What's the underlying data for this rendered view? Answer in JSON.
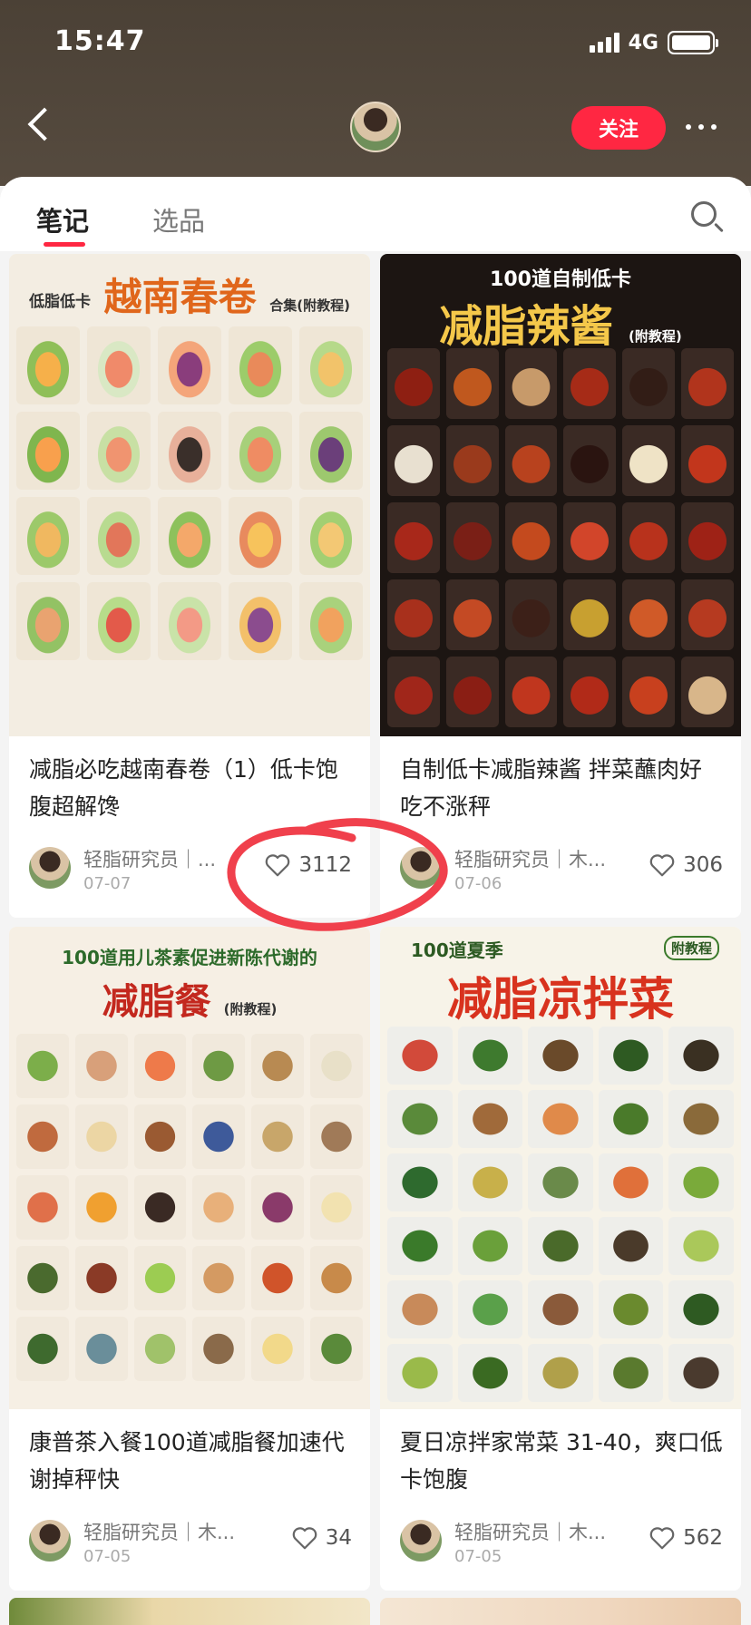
{
  "status_bar": {
    "time": "15:47",
    "network": "4G"
  },
  "header": {
    "follow_label": "关注"
  },
  "tabs": [
    {
      "label": "笔记"
    },
    {
      "label": "选品"
    }
  ],
  "posts": [
    {
      "cover_lines": [
        "低脂低卡",
        "越南春卷",
        "合集(附教程)"
      ],
      "title": "减脂必吃越南春卷（1）低卡饱腹超解馋",
      "author": "轻脂研究员｜...",
      "date": "07-07",
      "likes": "3112"
    },
    {
      "cover_lines": [
        "100道自制低卡",
        "减脂辣酱",
        "(附教程)"
      ],
      "title": "自制低卡减脂辣酱 拌菜蘸肉好吃不涨秤",
      "author": "轻脂研究员｜木...",
      "date": "07-06",
      "likes": "306"
    },
    {
      "cover_lines": [
        "100道用儿茶素促进新陈代谢的",
        "减脂餐",
        "(附教程)"
      ],
      "title": "康普茶入餐100道减脂餐加速代谢掉秤快",
      "author": "轻脂研究员｜木...",
      "date": "07-05",
      "likes": "34"
    },
    {
      "cover_lines": [
        "100道夏季",
        "减脂凉拌菜",
        "附教程"
      ],
      "title": "夏日凉拌家常菜 31-40，爽口低卡饱腹",
      "author": "轻脂研究员｜木...",
      "date": "07-05",
      "likes": "562"
    }
  ],
  "colors": {
    "header_bg": "#4b4136",
    "accent": "#ff2742",
    "annotation": "#f0404c"
  }
}
